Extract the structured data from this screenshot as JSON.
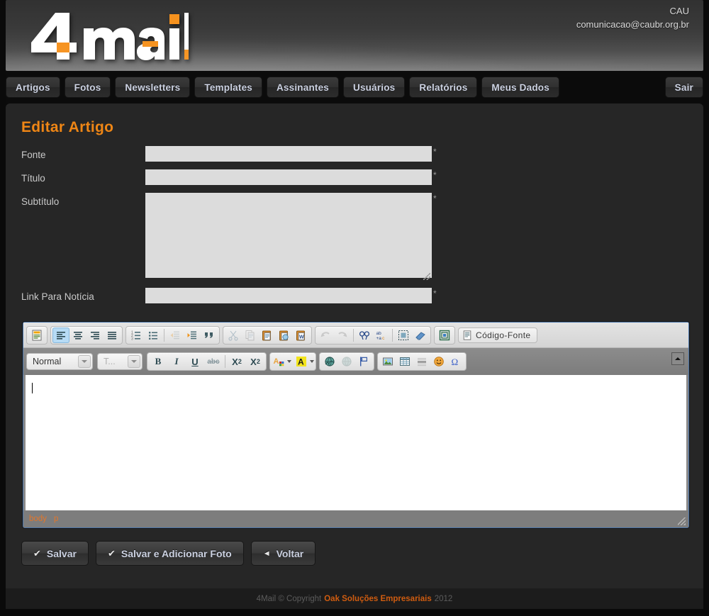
{
  "header": {
    "logo_text": "4mail",
    "account_name": "CAU",
    "account_email": "comunicacao@caubr.org.br"
  },
  "nav": {
    "items": [
      {
        "label": "Artigos"
      },
      {
        "label": "Fotos"
      },
      {
        "label": "Newsletters"
      },
      {
        "label": "Templates"
      },
      {
        "label": "Assinantes"
      },
      {
        "label": "Usuários"
      },
      {
        "label": "Relatórios"
      },
      {
        "label": "Meus Dados"
      }
    ],
    "logout_label": "Sair"
  },
  "page": {
    "title": "Editar Artigo",
    "required_mark": "*"
  },
  "form": {
    "fields": [
      {
        "label": "Fonte",
        "value": "",
        "placeholder": ""
      },
      {
        "label": "Título",
        "value": "",
        "placeholder": ""
      },
      {
        "label": "Subtítulo",
        "value": "",
        "placeholder": ""
      },
      {
        "label": "Link Para Notícia",
        "value": "",
        "placeholder": ""
      }
    ]
  },
  "editor": {
    "source_button_label": "Código-Fonte",
    "format_combo_value": "Normal",
    "font_combo_value": "T...",
    "body_value": "",
    "elements_path": [
      "body",
      "p"
    ],
    "toolbar_row1": [
      {
        "name": "templates-icon",
        "title": "Modelos",
        "disabled": false
      },
      {
        "name": "justify-left-icon",
        "title": "Alinhar à Esquerda",
        "active": true
      },
      {
        "name": "justify-center-icon",
        "title": "Centralizar",
        "disabled": false
      },
      {
        "name": "justify-right-icon",
        "title": "Alinhar à Direita",
        "disabled": false
      },
      {
        "name": "justify-block-icon",
        "title": "Justificado",
        "disabled": false
      },
      {
        "name": "numbered-list-icon",
        "title": "Lista Numerada",
        "disabled": false
      },
      {
        "name": "bulleted-list-icon",
        "title": "Lista com Marcadores",
        "disabled": false
      },
      {
        "name": "outdent-icon",
        "title": "Diminuir Recuo",
        "disabled": true
      },
      {
        "name": "indent-icon",
        "title": "Aumentar Recuo",
        "disabled": false
      },
      {
        "name": "blockquote-icon",
        "title": "Citação",
        "disabled": false
      },
      {
        "name": "cut-icon",
        "title": "Recortar",
        "disabled": true
      },
      {
        "name": "copy-icon",
        "title": "Copiar",
        "disabled": true
      },
      {
        "name": "paste-icon",
        "title": "Colar",
        "disabled": false
      },
      {
        "name": "paste-text-icon",
        "title": "Colar como Texto sem Formatação",
        "disabled": false
      },
      {
        "name": "paste-word-icon",
        "title": "Colar do Word",
        "disabled": false
      },
      {
        "name": "undo-icon",
        "title": "Desfazer",
        "disabled": true
      },
      {
        "name": "redo-icon",
        "title": "Refazer",
        "disabled": true
      },
      {
        "name": "find-icon",
        "title": "Localizar",
        "disabled": false
      },
      {
        "name": "replace-icon",
        "title": "Substituir",
        "disabled": false
      },
      {
        "name": "select-all-icon",
        "title": "Selecionar Tudo",
        "disabled": false
      },
      {
        "name": "remove-format-icon",
        "title": "Remover Formatação",
        "disabled": false
      },
      {
        "name": "maximize-icon",
        "title": "Maximizar",
        "disabled": false
      }
    ],
    "toolbar_row2": [
      {
        "name": "bold-icon",
        "label": "B",
        "title": "Negrito"
      },
      {
        "name": "italic-icon",
        "label": "I",
        "title": "Itálico"
      },
      {
        "name": "underline-icon",
        "label": "U",
        "title": "Sublinhado"
      },
      {
        "name": "strikethrough-icon",
        "label": "abc",
        "title": "Tachado"
      },
      {
        "name": "subscript-icon",
        "label": "X2",
        "title": "Subscrito"
      },
      {
        "name": "superscript-icon",
        "label": "X2",
        "title": "Sobrescrito"
      },
      {
        "name": "text-color-icon",
        "title": "Cor do Texto"
      },
      {
        "name": "background-color-icon",
        "title": "Cor do Fundo"
      },
      {
        "name": "link-icon",
        "title": "Inserir Link",
        "disabled": false
      },
      {
        "name": "unlink-icon",
        "title": "Remover Link",
        "disabled": true
      },
      {
        "name": "anchor-icon",
        "title": "Âncora",
        "disabled": false
      },
      {
        "name": "image-icon",
        "title": "Imagem",
        "disabled": false
      },
      {
        "name": "table-icon",
        "title": "Tabela",
        "disabled": false
      },
      {
        "name": "horizontal-rule-icon",
        "title": "Linha Horizontal",
        "disabled": false
      },
      {
        "name": "smiley-icon",
        "title": "Smiley",
        "disabled": false
      },
      {
        "name": "special-char-icon",
        "title": "Caractere Especial",
        "disabled": false
      }
    ]
  },
  "actions": [
    {
      "label": "Salvar",
      "icon": "✔"
    },
    {
      "label": "Salvar e Adicionar Foto",
      "icon": "✔"
    },
    {
      "label": "Voltar",
      "icon": "◄"
    }
  ],
  "footer": {
    "prefix": "4Mail © Copyright",
    "brand": "Oak Soluções Empresariais",
    "year": "2012"
  },
  "colors": {
    "accent": "#ef8615",
    "brand_orange": "#cf5c10",
    "panel_bg": "#262626",
    "nav_text": "#ccd2e2",
    "editor_border": "#4a74a8"
  }
}
